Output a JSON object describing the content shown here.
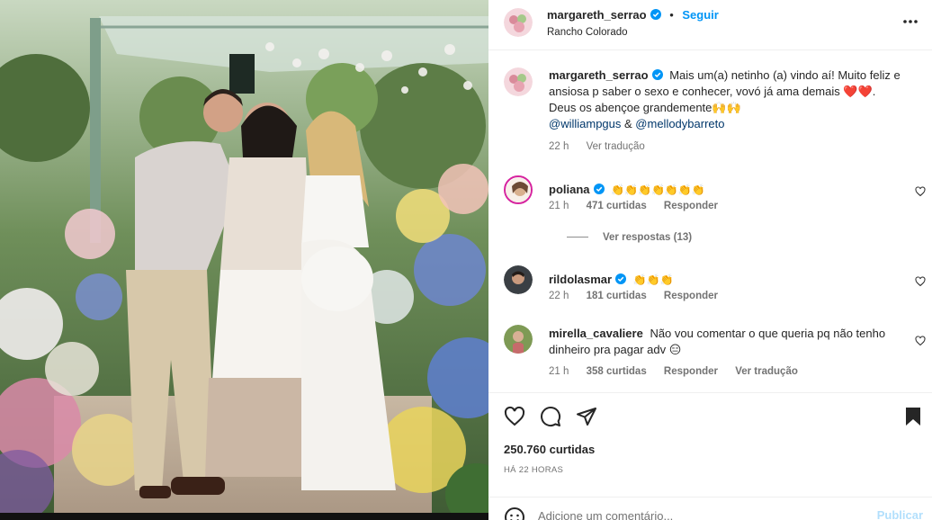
{
  "post": {
    "author": "margareth_serrao",
    "follow_label": "Seguir",
    "separator": "•",
    "location": "Rancho Colorado",
    "photo_description_icon": "family-photo"
  },
  "caption": {
    "username": "margareth_serrao",
    "text": "Mais um(a) netinho (a) vindo aí! Muito feliz e ansiosa p saber o sexo e conhecer, vovó já ama demais ❤️❤️. Deus os abençoe grandemente🙌🙌",
    "mention_1": "@williampgus",
    "and": " & ",
    "mention_2": "@mellodybarreto",
    "time": "22 h",
    "translate": "Ver tradução"
  },
  "comments": [
    {
      "username": "poliana",
      "text": "👏👏👏👏👏👏👏",
      "time": "21 h",
      "likes": "471 curtidas",
      "reply": "Responder",
      "view_replies": "Ver respostas (13)"
    },
    {
      "username": "rildolasmar",
      "text": "👏👏👏",
      "time": "22 h",
      "likes": "181 curtidas",
      "reply": "Responder"
    },
    {
      "username": "mirella_cavaliere",
      "text": "Não vou comentar o que queria pq não tenho dinheiro pra pagar adv 😑",
      "time": "21 h",
      "likes": "358 curtidas",
      "reply": "Responder",
      "translate": "Ver tradução"
    }
  ],
  "footer": {
    "likes": "250.760 curtidas",
    "ago": "HÁ 22 HORAS",
    "comment_placeholder": "Adicione um comentário...",
    "publish_label": "Publicar"
  },
  "icons": {
    "like": "heart-icon",
    "comment": "comment-icon",
    "share": "share-icon",
    "save": "bookmark-icon",
    "more": "more-options-icon",
    "emoji": "emoji-icon",
    "verified": "verified-badge-icon"
  },
  "colors": {
    "accent": "#0095f6",
    "mention": "#00376b",
    "muted": "#737373",
    "publish_disabled": "#b2dffc",
    "verified": "#0095f6"
  }
}
